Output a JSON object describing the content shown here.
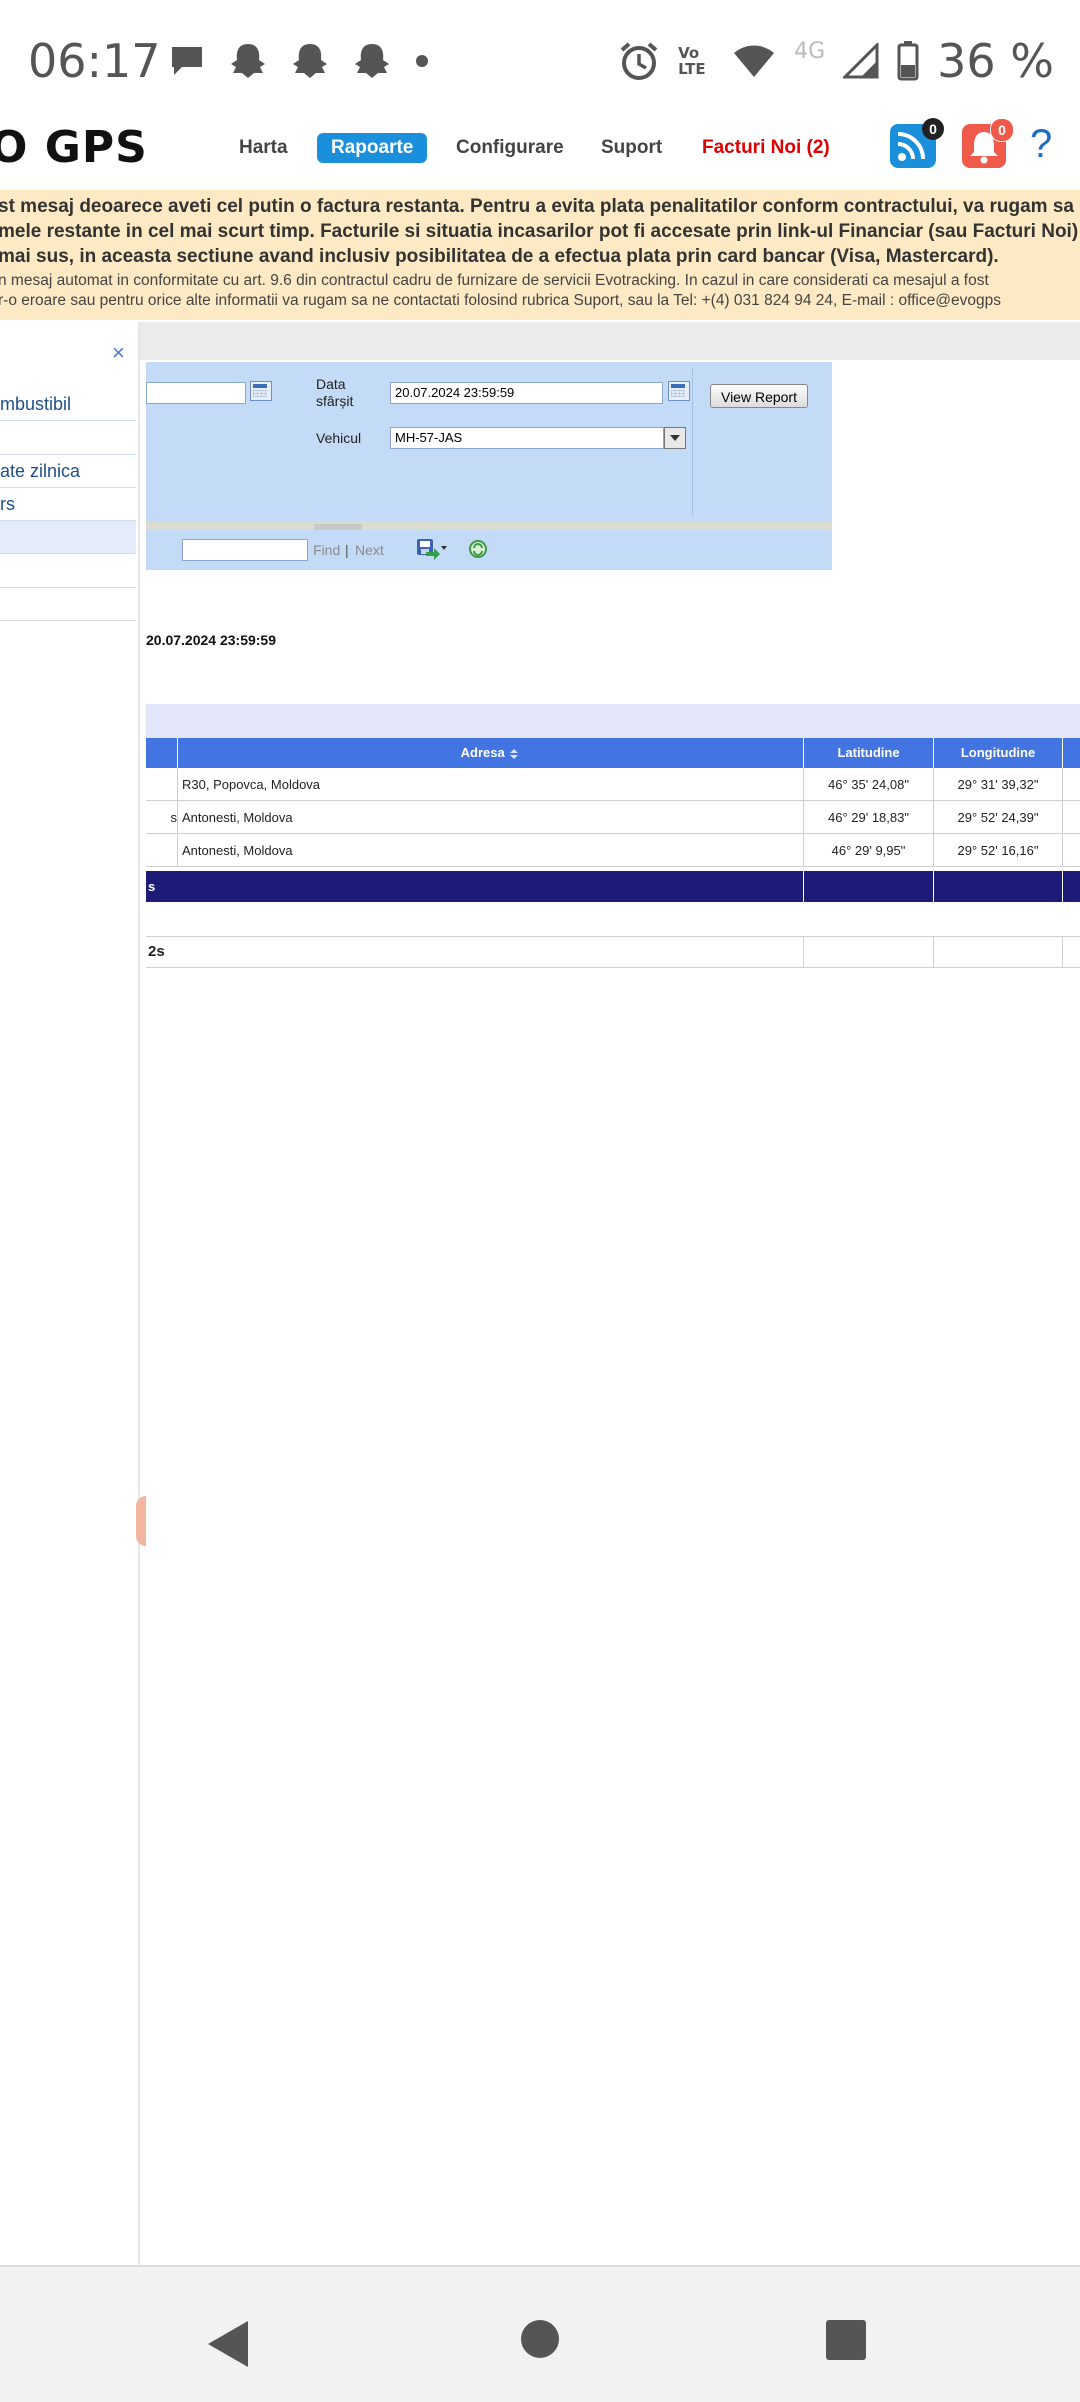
{
  "status_bar": {
    "time": "06:17",
    "battery_percent": "36 %",
    "network_label": "4G",
    "volte_label": "Vo LTE",
    "left_icons": [
      "chat-bubble-icon",
      "snapchat-icon",
      "snapchat-icon",
      "snapchat-icon",
      "dot-icon"
    ],
    "right_icons": [
      "alarm-icon",
      "volte-icon",
      "wifi-icon",
      "cell-signal-icon",
      "battery-icon"
    ]
  },
  "header": {
    "logo_text": "O GPS",
    "nav": [
      "Harta",
      "Rapoarte",
      "Configurare",
      "Suport",
      "Facturi Noi (2)"
    ],
    "active_nav": "Rapoarte",
    "feed_count": "0",
    "alerts_count": "0",
    "help_label": "?"
  },
  "banner": {
    "line1": "st mesaj deoarece aveti cel putin o factura restanta. Pentru a evita plata penalitatilor conform contractului, va rugam sa",
    "line2": "mele restante in cel mai scurt timp. Facturile si situatia incasarilor pot fi accesate prin link-ul Financiar (sau Facturi Noi)",
    "line3": "mai sus, in aceasta sectiune avand inclusiv posibilitatea de a efectua plata prin card bancar (Visa, Mastercard).",
    "line4": "n mesaj automat in conformitate cu art. 9.6 din contractul cadru de furnizare de servicii Evotracking. In cazul in care considerati ca mesajul a fost",
    "line5": "r-o eroare sau pentru orice alte informatii va rugam sa ne contactati folosind rubrica Suport, sau la Tel: +(4) 031 824 94 24, E-mail : office@evogps"
  },
  "sidebar": {
    "close_label": "×",
    "items": [
      "mbustibil",
      "",
      "ate zilnica",
      "rs",
      "",
      "",
      ""
    ]
  },
  "params": {
    "end_date_label": "Data sfârșit",
    "end_date_value": "20.07.2024 23:59:59",
    "start_date_value": "",
    "vehicle_label": "Vehicul",
    "vehicle_value": "MH-57-JAS",
    "view_report_label": "View Report"
  },
  "toolbar": {
    "find_value": "",
    "find_label": "Find",
    "separator": "|",
    "next_label": "Next"
  },
  "report": {
    "date_caption": "20.07.2024 23:59:59",
    "columns": [
      "Adresa",
      "Latitudine",
      "Longitudine"
    ],
    "rows": [
      {
        "prefix": "",
        "address": "R30,  Popovca,  Moldova",
        "lat": "46° 35' 24,08\"",
        "lon": "29° 31' 39,32\""
      },
      {
        "prefix": "s",
        "address": "Antonesti,  Moldova",
        "lat": "46° 29' 18,83\"",
        "lon": "29° 52' 24,39\""
      },
      {
        "prefix": "",
        "address": "Antonesti,  Moldova",
        "lat": "46° 29' 9,95\"",
        "lon": "29° 52' 16,16\""
      }
    ],
    "total_label": "s",
    "summary_label": "2s"
  }
}
